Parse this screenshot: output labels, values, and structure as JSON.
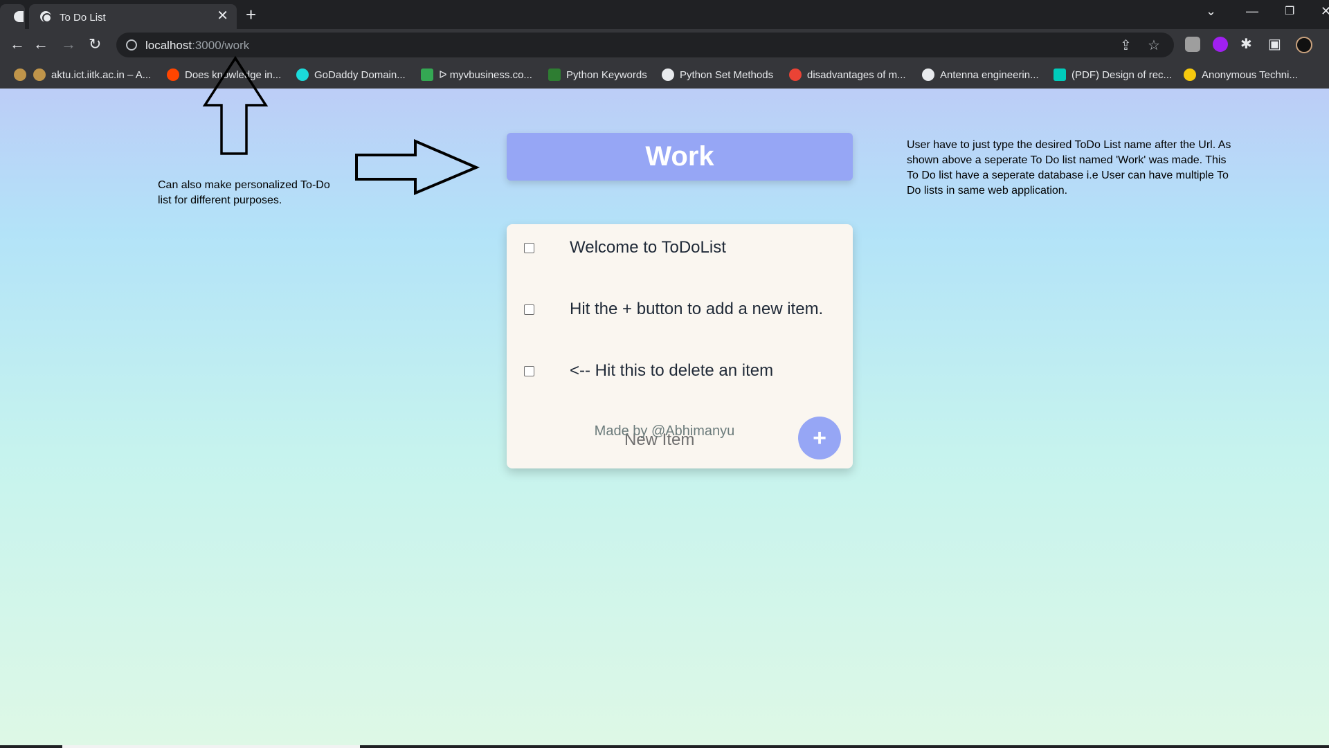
{
  "browser": {
    "tab_title": "To Do List",
    "url_host": "localhost",
    "url_path": ":3000/work",
    "bookmarks": [
      {
        "label": "aktu.ict.iitk.ac.in – A...",
        "color": "#c0954a"
      },
      {
        "label": "Does knowledge in...",
        "color": "#ff4500"
      },
      {
        "label": "GoDaddy Domain...",
        "color": "#1bdbdb"
      },
      {
        "label": "ᐅ myvbusiness.co...",
        "color": "#34a853"
      },
      {
        "label": "Python Keywords",
        "color": "#2e7d32"
      },
      {
        "label": "Python Set Methods",
        "color": "#e8eaed"
      },
      {
        "label": "disadvantages of m...",
        "color": "#ea4335"
      },
      {
        "label": "Antenna engineerin...",
        "color": "#e8eaed"
      },
      {
        "label": "(PDF) Design of rec...",
        "color": "#00ccbb"
      },
      {
        "label": "Anonymous Techni...",
        "color": "#f6c90e"
      }
    ]
  },
  "page": {
    "list_title": "Work",
    "items": [
      {
        "text": "Welcome to ToDoList"
      },
      {
        "text": "Hit the + button to add a new item."
      },
      {
        "text": "<-- Hit this to delete an item"
      }
    ],
    "new_item_placeholder": "New Item",
    "add_button": "+",
    "footer": "Made by @Abhimanyu"
  },
  "annotations": {
    "left_note": "Can also make personalized To-Do list for different purposes.",
    "right_note": "User have to just type the desired ToDo List name after the Url. As shown above a seperate To Do list named 'Work' was made. This To Do list have a seperate database i.e User can have multiple To Do lists in same web application."
  },
  "colors": {
    "accent": "#96a6f5",
    "card_bg": "#faf6f0",
    "gradient_top": "#bccdf7",
    "gradient_bottom": "#def8e6"
  }
}
